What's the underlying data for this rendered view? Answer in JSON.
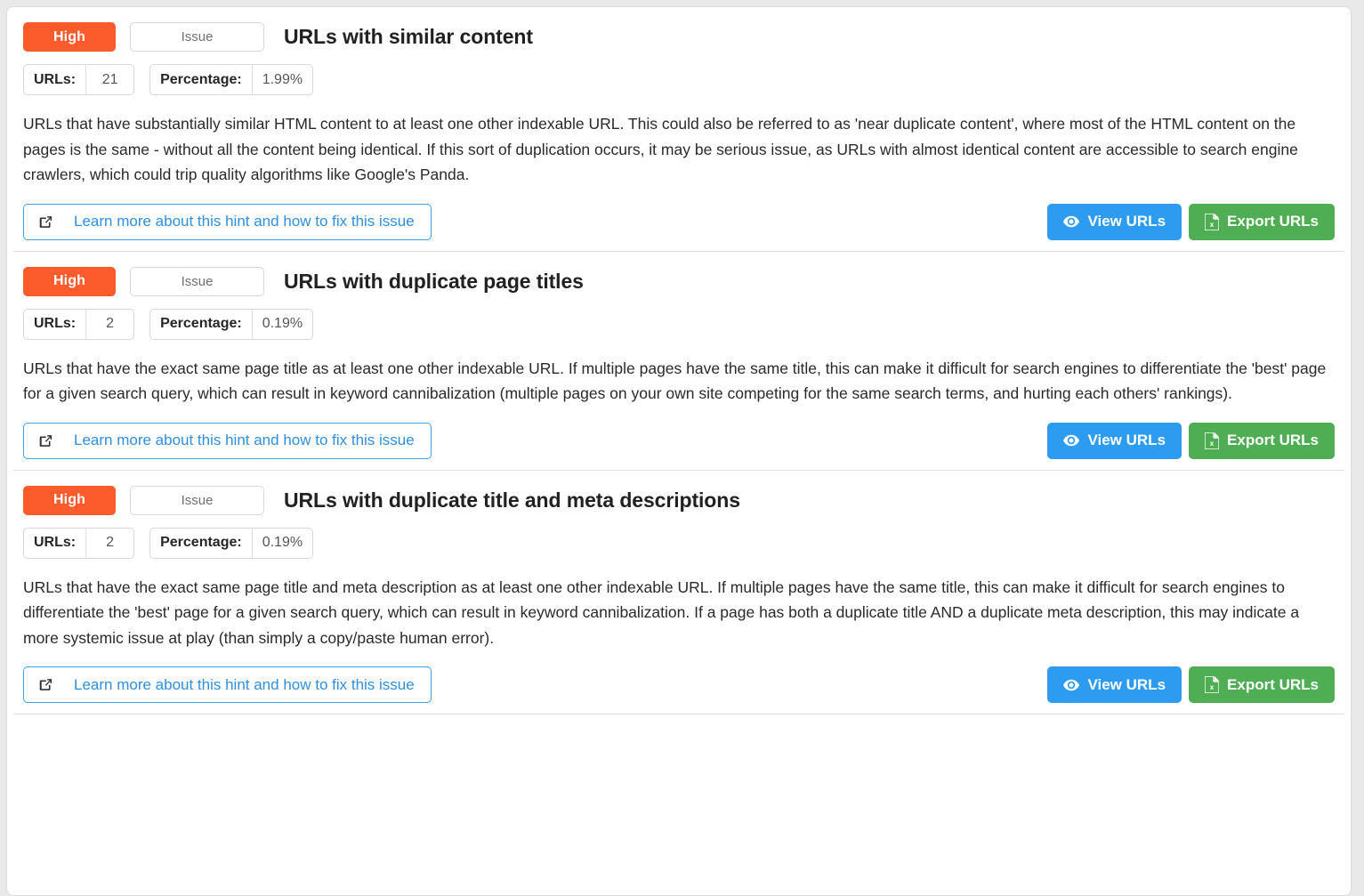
{
  "hints": [
    {
      "severity": "High",
      "type": "Issue",
      "title": "URLs with similar content",
      "metrics": [
        {
          "label": "URLs:",
          "value": "21"
        },
        {
          "label": "Percentage:",
          "value": "1.99%"
        }
      ],
      "description": "URLs that have substantially similar HTML content to at least one other indexable URL. This could also be referred to as 'near duplicate content', where most of the HTML content on the pages is the same - without all the content being identical. If this sort of duplication occurs, it may be serious issue, as URLs with almost identical content are accessible to search engine crawlers, which could trip quality algorithms like Google's Panda.",
      "learn_more_label": "Learn more about this hint and how to fix this issue",
      "view_label": "View URLs",
      "export_label": "Export URLs"
    },
    {
      "severity": "High",
      "type": "Issue",
      "title": "URLs with duplicate page titles",
      "metrics": [
        {
          "label": "URLs:",
          "value": "2"
        },
        {
          "label": "Percentage:",
          "value": "0.19%"
        }
      ],
      "description": "URLs that have the exact same page title as at least one other indexable URL. If multiple pages have the same title, this can make it difficult for search engines to differentiate the 'best' page for a given search query, which can result in keyword cannibalization (multiple pages on your own site competing for the same search terms, and hurting each others' rankings).",
      "learn_more_label": "Learn more about this hint and how to fix this issue",
      "view_label": "View URLs",
      "export_label": "Export URLs"
    },
    {
      "severity": "High",
      "type": "Issue",
      "title": "URLs with duplicate title and meta descriptions",
      "metrics": [
        {
          "label": "URLs:",
          "value": "2"
        },
        {
          "label": "Percentage:",
          "value": "0.19%"
        }
      ],
      "description": "URLs that have the exact same page title and meta description as at least one other indexable URL. If multiple pages have the same title, this can make it difficult for search engines to differentiate the 'best' page for a given search query, which can result in keyword cannibalization. If a page has both a duplicate title AND a duplicate meta description, this may indicate a more systemic issue at play (than simply a copy/paste human error).",
      "learn_more_label": "Learn more about this hint and how to fix this issue",
      "view_label": "View URLs",
      "export_label": "Export URLs"
    }
  ],
  "icons": {
    "learn_more": "external-link-icon",
    "view": "eye-icon",
    "export": "file-excel-icon"
  },
  "colors": {
    "severity_high": "#fc5b2c",
    "view_button": "#2d9cf0",
    "export_button": "#4fae54",
    "link": "#2f8fe0"
  }
}
